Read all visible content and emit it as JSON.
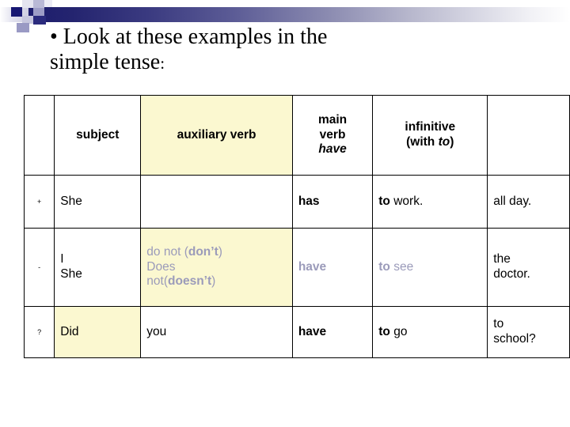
{
  "slide": {
    "title": "• Look at these examples in the\n   simple tense",
    "title_colon": ":"
  },
  "colors": {
    "highlight_cell": "#fbf8d0",
    "muted_text": "#9b9bba",
    "bar_dark": "#1d1d6e",
    "text": "#000000"
  },
  "table": {
    "headers": {
      "marker": "",
      "subject": "subject",
      "auxiliary": "auxiliary verb",
      "main_verb_line1": "main",
      "main_verb_line2": "verb",
      "main_verb_line3": "have",
      "infinitive_line1": "infinitive",
      "infinitive_paren_open": "(with ",
      "infinitive_to": "to",
      "infinitive_paren_close": ")",
      "tail": ""
    },
    "rows": [
      {
        "marker": "+",
        "subject": "She",
        "auxiliary": "",
        "main_verb": "has",
        "infinitive_bold": "to",
        "infinitive_rest": " work.",
        "tail": "all day."
      },
      {
        "marker": "-",
        "subject_line1": "I",
        "subject_line2": "She",
        "aux_l1_a": "do not (",
        "aux_l1_b": "don’t",
        "aux_l1_c": ")",
        "aux_l2": "Does",
        "aux_l3_a": "not(",
        "aux_l3_b": "doesn’t",
        "aux_l3_c": ")",
        "main_verb": "have",
        "infinitive_bold": "to",
        "infinitive_rest": " see",
        "tail_line1": "the",
        "tail_line2": "doctor."
      },
      {
        "marker": "?",
        "subject": "Did",
        "auxiliary": "you",
        "main_verb": "have",
        "infinitive_bold": "to",
        "infinitive_rest": " go",
        "tail_line1": "to",
        "tail_line2": "school?"
      }
    ]
  }
}
